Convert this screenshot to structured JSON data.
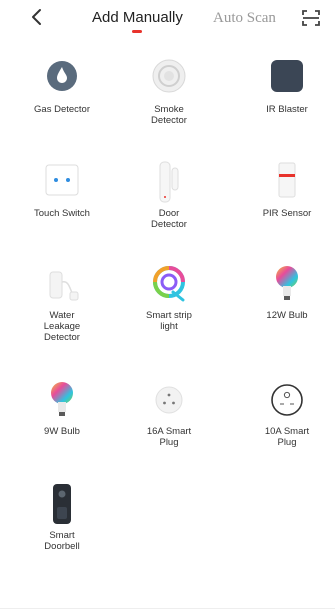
{
  "header": {
    "tabs": [
      {
        "label": "Add Manually",
        "active": true
      },
      {
        "label": "Auto Scan",
        "active": false
      }
    ],
    "back_icon": "chevron-left-icon",
    "scan_icon": "scan-frame-icon",
    "accent": "#e8332c"
  },
  "devices": [
    {
      "label": "Gas Detector",
      "icon": "gas-detector-icon"
    },
    {
      "label": "Smoke\nDetector",
      "icon": "smoke-detector-icon"
    },
    {
      "label": "IR Blaster",
      "icon": "ir-blaster-icon"
    },
    {
      "label": "Touch Switch",
      "icon": "touch-switch-icon"
    },
    {
      "label": "Door\nDetector",
      "icon": "door-detector-icon"
    },
    {
      "label": "PIR Sensor",
      "icon": "pir-sensor-icon"
    },
    {
      "label": "Water\nLeakage\nDetector",
      "icon": "water-leakage-icon"
    },
    {
      "label": "Smart strip\nlight",
      "icon": "smart-strip-light-icon"
    },
    {
      "label": "12W Bulb",
      "icon": "bulb-icon"
    },
    {
      "label": "9W Bulb",
      "icon": "bulb-icon"
    },
    {
      "label": "16A Smart\nPlug",
      "icon": "smart-plug-icon"
    },
    {
      "label": "10A Smart\nPlug",
      "icon": "smart-plug-round-icon"
    },
    {
      "label": "Smart\nDoorbell",
      "icon": "doorbell-icon"
    }
  ]
}
